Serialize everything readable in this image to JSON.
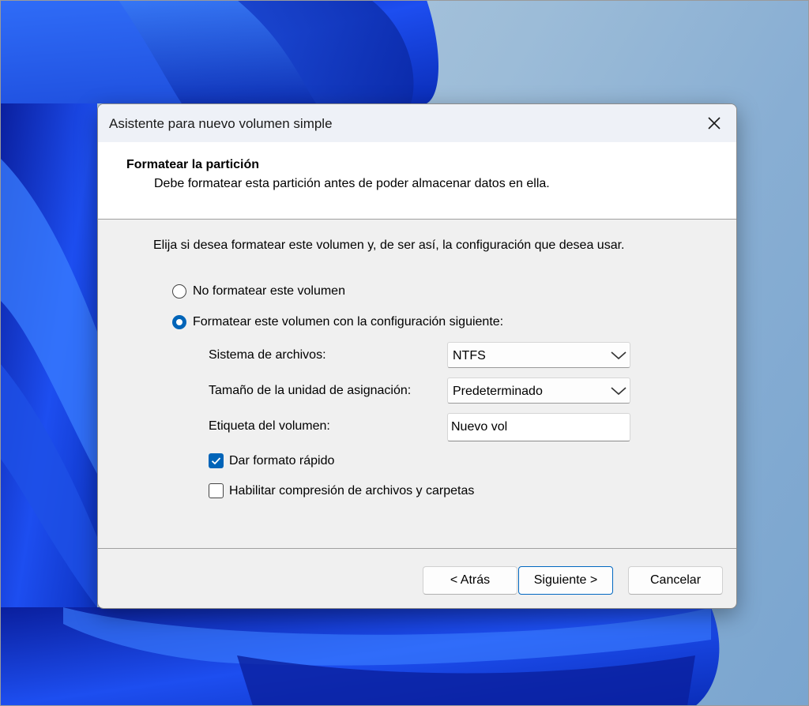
{
  "dialog": {
    "title": "Asistente para nuevo volumen simple"
  },
  "header": {
    "title": "Formatear la partición",
    "subtitle": "Debe formatear esta partición antes de poder almacenar datos en ella."
  },
  "body": {
    "instruction": "Elija si desea formatear este volumen y, de ser así, la configuración que desea usar.",
    "options": {
      "no_format": {
        "label": "No formatear este volumen",
        "selected": false
      },
      "format": {
        "label": "Formatear este volumen con la configuración siguiente:",
        "selected": true
      }
    },
    "fields": {
      "file_system": {
        "label": "Sistema de archivos:",
        "value": "NTFS"
      },
      "allocation_unit": {
        "label": "Tamaño de la unidad de asignación:",
        "value": "Predeterminado"
      },
      "volume_label": {
        "label": "Etiqueta del volumen:",
        "value": "Nuevo vol"
      }
    },
    "checkboxes": {
      "quick_format": {
        "label": "Dar formato rápido",
        "checked": true
      },
      "compression": {
        "label": "Habilitar compresión de archivos y carpetas",
        "checked": false
      }
    }
  },
  "buttons": {
    "back": "< Atrás",
    "next": "Siguiente >",
    "cancel": "Cancelar"
  },
  "colors": {
    "accent": "#0064b8",
    "wallpaper_blue": "#1a3fd0"
  },
  "icons": {
    "close": "close-icon",
    "dropdown": "chevron-down-icon",
    "check": "checkmark-icon"
  }
}
